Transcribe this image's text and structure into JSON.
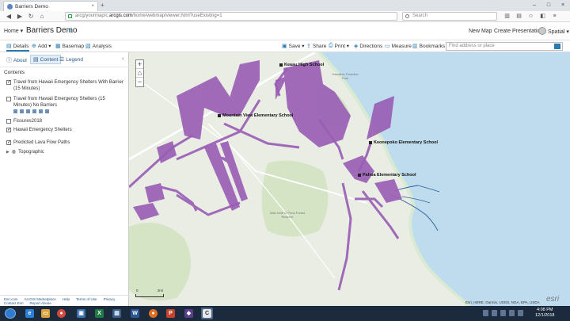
{
  "browser": {
    "tab_title": "Barriers Demo",
    "tab_close": "×",
    "new_tab": "+",
    "url_prefix": "arcg/yourmap/c.",
    "url_domain": "arcgis.com",
    "url_suffix": "/home/webmap/viewer.html?useExisting=1",
    "search_placeholder": "Search",
    "window_controls": [
      "–",
      "□",
      "×"
    ]
  },
  "app": {
    "home_label": "Home ▾",
    "map_title": "Barriers Demo",
    "new_map": "New Map",
    "create_presentation": "Create Presentation",
    "user": "Spatial ▾"
  },
  "toolbar": {
    "details": "Details",
    "add": "Add ▾",
    "basemap": "Basemap",
    "analysis": "Analysis",
    "save": "Save ▾",
    "share": "Share",
    "print": "Print ▾",
    "directions": "Directions",
    "measure": "Measure",
    "bookmarks": "Bookmarks",
    "address_placeholder": "Find address or place"
  },
  "panel": {
    "tabs": {
      "about": "About",
      "content": "Content",
      "legend": "Legend"
    },
    "contents_heading": "Contents",
    "layers": [
      {
        "label": "Travel from Hawaii Emergency Shelters With Barrier (15 Minutes)",
        "checked": true
      },
      {
        "label": "Travel from Hawaii Emergency Shelters (15 Minutes) No Barriers",
        "checked": false
      },
      {
        "label": "Fissures2018",
        "checked": false
      },
      {
        "label": "Hawaii Emergency Shelters",
        "checked": true
      },
      {
        "label": "Predicted Lava Flow Paths",
        "checked": true
      }
    ],
    "basemap_layer": "Topographic",
    "footer_links": [
      "Esri.com",
      "ArcGIS Marketplace",
      "Help",
      "Terms of Use",
      "Privacy",
      "Contact Esri",
      "Report Abuse"
    ]
  },
  "map": {
    "labels": {
      "keaau": "Keaau High School",
      "mountain_view": "Mountain View Elementary School",
      "keonepoko": "Keonepoko Elementary School",
      "pahoa": "Pahoa Elementary School"
    },
    "minor_labels": {
      "forest": "Wao Kele O Puna Forest Reserve",
      "hawaiian_paradise": "Hawaiian Paradise Park"
    },
    "scale": {
      "left": "0",
      "right": "2mi"
    },
    "attribution": "Esri, HERE, Garmin, USGS, NGA, EPA, USDA",
    "watermark": "esri",
    "zoom_in": "+",
    "zoom_out": "−",
    "home": "⌂"
  },
  "colors": {
    "service_area": "#9a5fb5",
    "ocean": "#bfdcef",
    "land": "#e9ede4",
    "forest": "#d4e4c4",
    "road": "#ffffff",
    "stream": "#2f5f9a"
  },
  "taskbar": {
    "time": "4:08 PM",
    "date": "12/1/2018"
  }
}
